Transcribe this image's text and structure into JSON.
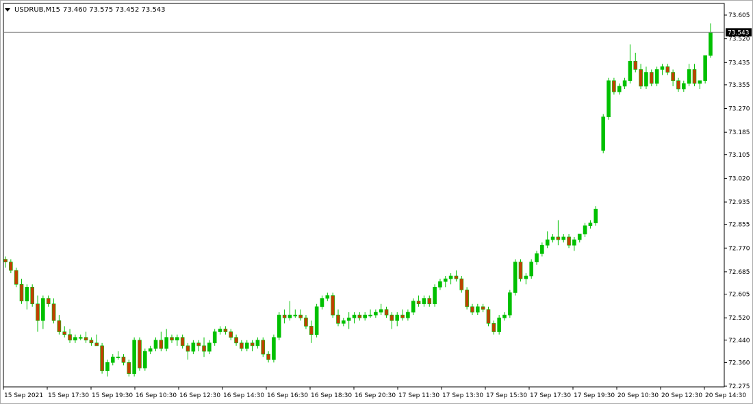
{
  "header": {
    "symbol": "USDRUB,M15",
    "ohlc": "73.460 73.575 73.452 73.543"
  },
  "colors": {
    "bull": "#00c000",
    "bear": "#c04000",
    "wick": "#00c000",
    "grid": "#808080"
  },
  "chart_data": {
    "type": "candlestick",
    "symbol": "USDRUB",
    "timeframe": "M15",
    "ylim": [
      72.275,
      73.65
    ],
    "y_ticks": [
      "73.605",
      "73.520",
      "73.435",
      "73.355",
      "73.270",
      "73.185",
      "73.105",
      "73.020",
      "72.935",
      "72.855",
      "72.770",
      "72.685",
      "72.605",
      "72.520",
      "72.440",
      "72.360",
      "72.275"
    ],
    "current_price": "73.543",
    "x_labels": [
      "15 Sep 2021",
      "15 Sep 17:30",
      "15 Sep 19:30",
      "16 Sep 10:30",
      "16 Sep 12:30",
      "16 Sep 14:30",
      "16 Sep 16:30",
      "16 Sep 18:30",
      "16 Sep 20:30",
      "17 Sep 11:30",
      "17 Sep 13:30",
      "17 Sep 15:30",
      "17 Sep 17:30",
      "17 Sep 19:30",
      "20 Sep 10:30",
      "20 Sep 12:30",
      "20 Sep 14:30"
    ],
    "candles": [
      [
        72.73,
        72.74,
        72.7,
        72.72
      ],
      [
        72.72,
        72.73,
        72.68,
        72.69
      ],
      [
        72.69,
        72.7,
        72.63,
        72.64
      ],
      [
        72.64,
        72.66,
        72.57,
        72.58
      ],
      [
        72.58,
        72.64,
        72.55,
        72.63
      ],
      [
        72.63,
        72.64,
        72.56,
        72.57
      ],
      [
        72.57,
        72.6,
        72.47,
        72.51
      ],
      [
        72.51,
        72.6,
        72.48,
        72.59
      ],
      [
        72.59,
        72.6,
        72.56,
        72.57
      ],
      [
        72.57,
        72.59,
        72.5,
        72.51
      ],
      [
        72.51,
        72.53,
        72.46,
        72.47
      ],
      [
        72.47,
        72.49,
        72.45,
        72.46
      ],
      [
        72.46,
        72.48,
        72.43,
        72.44
      ],
      [
        72.44,
        72.46,
        72.43,
        72.45
      ],
      [
        72.45,
        72.46,
        72.44,
        72.45
      ],
      [
        72.45,
        72.47,
        72.43,
        72.44
      ],
      [
        72.44,
        72.45,
        72.42,
        72.43
      ],
      [
        72.43,
        72.46,
        72.42,
        72.42
      ],
      [
        72.42,
        72.43,
        72.32,
        72.33
      ],
      [
        72.33,
        72.37,
        72.31,
        72.36
      ],
      [
        72.36,
        72.39,
        72.35,
        72.38
      ],
      [
        72.38,
        72.4,
        72.37,
        72.38
      ],
      [
        72.38,
        72.39,
        72.35,
        72.36
      ],
      [
        72.36,
        72.37,
        72.31,
        72.32
      ],
      [
        72.32,
        72.45,
        72.31,
        72.44
      ],
      [
        72.44,
        72.45,
        72.33,
        72.34
      ],
      [
        72.34,
        72.41,
        72.33,
        72.4
      ],
      [
        72.4,
        72.42,
        72.39,
        72.41
      ],
      [
        72.41,
        72.45,
        72.4,
        72.44
      ],
      [
        72.44,
        72.47,
        72.4,
        72.41
      ],
      [
        72.41,
        72.48,
        72.4,
        72.45
      ],
      [
        72.45,
        72.46,
        72.43,
        72.44
      ],
      [
        72.44,
        72.46,
        72.42,
        72.45
      ],
      [
        72.45,
        72.46,
        72.41,
        72.42
      ],
      [
        72.42,
        72.43,
        72.37,
        72.4
      ],
      [
        72.4,
        72.44,
        72.39,
        72.43
      ],
      [
        72.43,
        72.44,
        72.4,
        72.42
      ],
      [
        72.42,
        72.45,
        72.38,
        72.4
      ],
      [
        72.4,
        72.44,
        72.39,
        72.43
      ],
      [
        72.43,
        72.48,
        72.42,
        72.47
      ],
      [
        72.47,
        72.49,
        72.46,
        72.48
      ],
      [
        72.48,
        72.49,
        72.46,
        72.47
      ],
      [
        72.47,
        72.48,
        72.44,
        72.45
      ],
      [
        72.45,
        72.46,
        72.42,
        72.43
      ],
      [
        72.43,
        72.44,
        72.4,
        72.41
      ],
      [
        72.41,
        72.44,
        72.4,
        72.43
      ],
      [
        72.43,
        72.44,
        72.4,
        72.42
      ],
      [
        72.42,
        72.45,
        72.41,
        72.44
      ],
      [
        72.44,
        72.45,
        72.38,
        72.39
      ],
      [
        72.39,
        72.4,
        72.36,
        72.37
      ],
      [
        72.37,
        72.46,
        72.36,
        72.45
      ],
      [
        72.45,
        72.54,
        72.44,
        72.53
      ],
      [
        72.53,
        72.55,
        72.5,
        72.52
      ],
      [
        72.52,
        72.58,
        72.51,
        72.53
      ],
      [
        72.53,
        72.55,
        72.52,
        72.53
      ],
      [
        72.53,
        72.55,
        72.51,
        72.52
      ],
      [
        72.52,
        72.53,
        72.48,
        72.49
      ],
      [
        72.49,
        72.51,
        72.43,
        72.46
      ],
      [
        72.46,
        72.57,
        72.45,
        72.56
      ],
      [
        72.56,
        72.6,
        72.55,
        72.59
      ],
      [
        72.59,
        72.61,
        72.58,
        72.6
      ],
      [
        72.6,
        72.61,
        72.52,
        72.53
      ],
      [
        72.53,
        72.55,
        72.49,
        72.5
      ],
      [
        72.5,
        72.52,
        72.49,
        72.51
      ],
      [
        72.51,
        72.54,
        72.48,
        72.52
      ],
      [
        72.52,
        72.54,
        72.5,
        72.53
      ],
      [
        72.53,
        72.54,
        72.51,
        72.52
      ],
      [
        72.52,
        72.54,
        72.51,
        72.53
      ],
      [
        72.53,
        72.55,
        72.52,
        72.53
      ],
      [
        72.53,
        72.55,
        72.52,
        72.54
      ],
      [
        72.54,
        72.57,
        72.53,
        72.55
      ],
      [
        72.55,
        72.56,
        72.52,
        72.53
      ],
      [
        72.53,
        72.54,
        72.48,
        72.51
      ],
      [
        72.51,
        72.54,
        72.49,
        72.53
      ],
      [
        72.53,
        72.55,
        72.51,
        72.52
      ],
      [
        72.52,
        72.55,
        72.51,
        72.54
      ],
      [
        72.54,
        72.59,
        72.53,
        72.58
      ],
      [
        72.58,
        72.6,
        72.56,
        72.57
      ],
      [
        72.57,
        72.6,
        72.56,
        72.59
      ],
      [
        72.59,
        72.6,
        72.56,
        72.57
      ],
      [
        72.57,
        72.64,
        72.56,
        72.63
      ],
      [
        72.63,
        72.66,
        72.62,
        72.65
      ],
      [
        72.65,
        72.67,
        72.63,
        72.66
      ],
      [
        72.66,
        72.68,
        72.64,
        72.67
      ],
      [
        72.67,
        72.69,
        72.65,
        72.66
      ],
      [
        72.66,
        72.67,
        72.61,
        72.62
      ],
      [
        72.62,
        72.63,
        72.55,
        72.56
      ],
      [
        72.56,
        72.57,
        72.53,
        72.54
      ],
      [
        72.54,
        72.57,
        72.53,
        72.56
      ],
      [
        72.56,
        72.57,
        72.54,
        72.55
      ],
      [
        72.55,
        72.56,
        72.49,
        72.5
      ],
      [
        72.5,
        72.51,
        72.46,
        72.47
      ],
      [
        72.47,
        72.53,
        72.46,
        72.52
      ],
      [
        72.52,
        72.54,
        72.51,
        72.53
      ],
      [
        72.53,
        72.62,
        72.52,
        72.61
      ],
      [
        72.61,
        72.73,
        72.6,
        72.72
      ],
      [
        72.72,
        72.73,
        72.65,
        72.66
      ],
      [
        72.66,
        72.68,
        72.64,
        72.67
      ],
      [
        72.67,
        72.73,
        72.66,
        72.72
      ],
      [
        72.72,
        72.76,
        72.71,
        72.75
      ],
      [
        72.75,
        72.79,
        72.74,
        72.78
      ],
      [
        72.78,
        72.83,
        72.77,
        72.8
      ],
      [
        72.8,
        72.82,
        72.79,
        72.81
      ],
      [
        72.81,
        72.87,
        72.78,
        72.8
      ],
      [
        72.8,
        72.82,
        72.79,
        72.81
      ],
      [
        72.81,
        72.82,
        72.77,
        72.78
      ],
      [
        72.78,
        72.81,
        72.76,
        72.8
      ],
      [
        72.8,
        72.82,
        72.79,
        72.82
      ],
      [
        72.82,
        72.86,
        72.81,
        72.85
      ],
      [
        72.85,
        72.87,
        72.84,
        72.86
      ],
      [
        72.86,
        72.92,
        72.85,
        72.91
      ],
      [
        73.12,
        73.25,
        73.11,
        73.24
      ],
      [
        73.24,
        73.38,
        73.23,
        73.37
      ],
      [
        73.37,
        73.38,
        73.32,
        73.33
      ],
      [
        73.33,
        73.36,
        73.32,
        73.35
      ],
      [
        73.35,
        73.38,
        73.34,
        73.37
      ],
      [
        73.37,
        73.5,
        73.36,
        73.44
      ],
      [
        73.44,
        73.47,
        73.4,
        73.41
      ],
      [
        73.41,
        73.43,
        73.34,
        73.35
      ],
      [
        73.35,
        73.42,
        73.34,
        73.4
      ],
      [
        73.4,
        73.41,
        73.35,
        73.36
      ],
      [
        73.36,
        73.42,
        73.35,
        73.41
      ],
      [
        73.41,
        73.43,
        73.39,
        73.42
      ],
      [
        73.42,
        73.43,
        73.39,
        73.4
      ],
      [
        73.4,
        73.41,
        73.35,
        73.37
      ],
      [
        73.37,
        73.38,
        73.33,
        73.34
      ],
      [
        73.34,
        73.37,
        73.33,
        73.36
      ],
      [
        73.36,
        73.43,
        73.35,
        73.41
      ],
      [
        73.41,
        73.43,
        73.35,
        73.36
      ],
      [
        73.36,
        73.37,
        73.34,
        73.37
      ],
      [
        73.37,
        73.46,
        73.36,
        73.46
      ],
      [
        73.46,
        73.575,
        73.452,
        73.543
      ]
    ]
  }
}
